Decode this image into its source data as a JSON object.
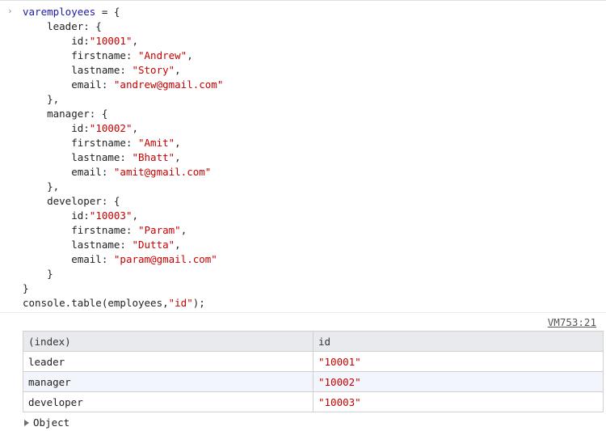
{
  "console": {
    "code_lines": [
      [
        "kw:var",
        "var:employees",
        "txt: = {"
      ],
      [
        "txt:    leader: {"
      ],
      [
        "txt:        id:",
        "str:\"10001\"",
        "txt:,"
      ],
      [
        "txt:        firstname: ",
        "str:\"Andrew\"",
        "txt:,"
      ],
      [
        "txt:        lastname: ",
        "str:\"Story\"",
        "txt:,"
      ],
      [
        "txt:        email: ",
        "str:\"andrew@gmail.com\""
      ],
      [
        "txt:    },"
      ],
      [
        "txt:    manager: {"
      ],
      [
        "txt:        id:",
        "str:\"10002\"",
        "txt:,"
      ],
      [
        "txt:        firstname: ",
        "str:\"Amit\"",
        "txt:,"
      ],
      [
        "txt:        lastname: ",
        "str:\"Bhatt\"",
        "txt:,"
      ],
      [
        "txt:        email: ",
        "str:\"amit@gmail.com\""
      ],
      [
        "txt:    },"
      ],
      [
        "txt:    developer: {"
      ],
      [
        "txt:        id:",
        "str:\"10003\"",
        "txt:,"
      ],
      [
        "txt:        firstname: ",
        "str:\"Param\"",
        "txt:,"
      ],
      [
        "txt:        lastname: ",
        "str:\"Dutta\"",
        "txt:,"
      ],
      [
        "txt:        email: ",
        "str:\"param@gmail.com\""
      ],
      [
        "txt:    }"
      ],
      [
        "txt:}"
      ],
      [
        "txt:console.table(employees,",
        "str:\"id\"",
        "txt:);"
      ]
    ],
    "prompt_symbol": "›",
    "output": {
      "source_link": "VM753:21",
      "table": {
        "headers": [
          "(index)",
          "id"
        ],
        "rows": [
          [
            "leader",
            "\"10001\""
          ],
          [
            "manager",
            "\"10002\""
          ],
          [
            "developer",
            "\"10003\""
          ]
        ]
      },
      "object_label": "Object"
    }
  },
  "colors": {
    "keyword": "#1a1aa6",
    "string": "#c80000",
    "header_bg": "#e8eaed",
    "alt_row_bg": "#f2f5fb"
  },
  "icons": [
    "chevron-right-icon",
    "triangle-right-icon"
  ]
}
